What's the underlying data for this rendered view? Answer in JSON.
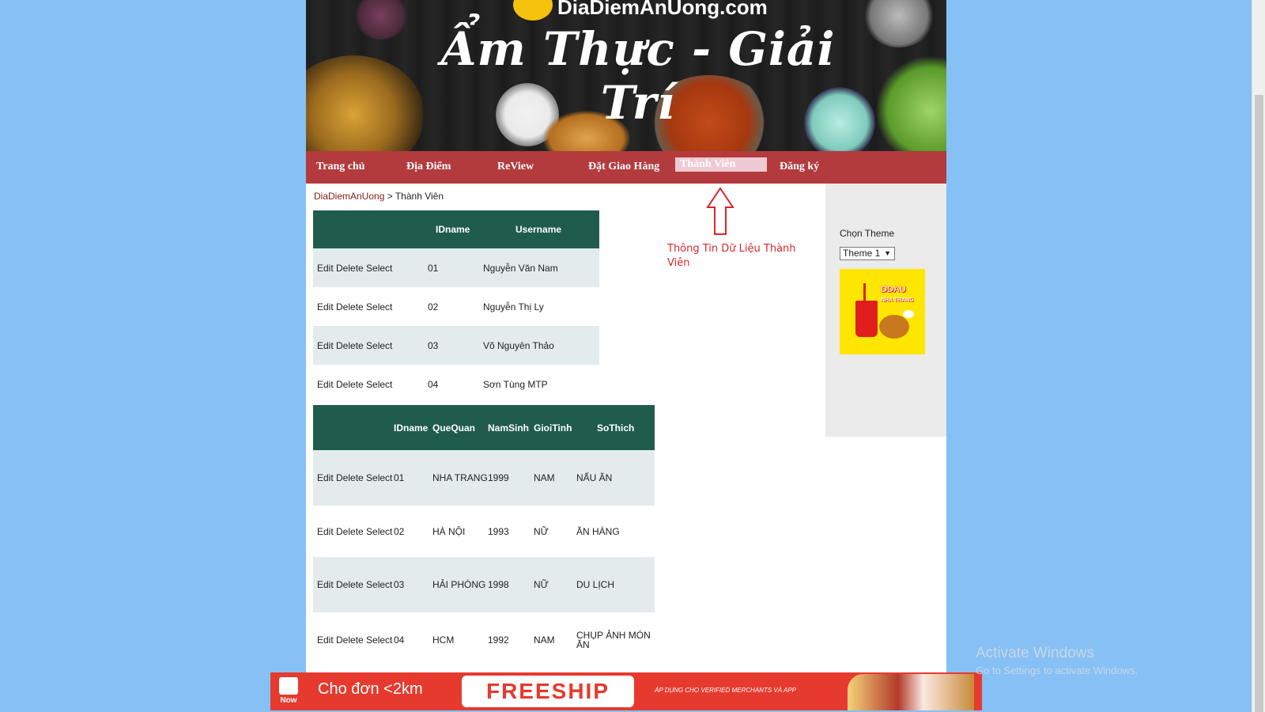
{
  "banner": {
    "logo_text": "DiaDiemAnUong.com",
    "title": "Ẩm Thực - Giải Trí"
  },
  "nav": {
    "items": [
      "Trang chủ",
      "Địa Điểm",
      "ReView",
      "Đặt Giao Hàng",
      "Thành Viên",
      "Đăng ký"
    ],
    "active_index": 4
  },
  "breadcrumb": {
    "home": "DiaDiemAnUong",
    "separator": " > ",
    "current": "Thành Viên"
  },
  "members_table": {
    "headers": [
      "",
      "IDname",
      "Username"
    ],
    "rows": [
      {
        "action": "Edit Delete Select",
        "id": "01",
        "username": "Nguyễn Văn Nam"
      },
      {
        "action": "Edit Delete Select",
        "id": "02",
        "username": "Nguyễn Thị Ly"
      },
      {
        "action": "Edit Delete Select",
        "id": "03",
        "username": "Võ Nguyên Thảo"
      },
      {
        "action": "Edit Delete Select",
        "id": "04",
        "username": "Sơn Tùng MTP"
      }
    ]
  },
  "details_table": {
    "headers": [
      "",
      "IDname",
      "QueQuan",
      "NamSinh",
      "GioiTinh",
      "SoThich"
    ],
    "rows": [
      {
        "action": "Edit Delete Select",
        "id": "01",
        "quequan": "NHA TRANG",
        "namsinh": "1999",
        "gioitinh": "NAM",
        "sothich": "NẤU ĂN"
      },
      {
        "action": "Edit Delete Select",
        "id": "02",
        "quequan": "HÀ NỘI",
        "namsinh": "1993",
        "gioitinh": "NỮ",
        "sothich": "ĂN HÀNG"
      },
      {
        "action": "Edit Delete Select",
        "id": "03",
        "quequan": "HẢI PHÒNG",
        "namsinh": "1998",
        "gioitinh": "NỮ",
        "sothich": "DU LỊCH"
      },
      {
        "action": "Edit Delete Select",
        "id": "04",
        "quequan": "HCM",
        "namsinh": "1992",
        "gioitinh": "NAM",
        "sothich": "CHỤP ẢNH MÓN ĂN"
      }
    ]
  },
  "annotation": {
    "text": "Thông Tin Dữ Liệu Thành Viên",
    "icon": "up-arrow-icon",
    "color": "#d9262b"
  },
  "sidebar": {
    "theme_label": "Chọn Theme",
    "theme_selected": "Theme 1",
    "ad_text_1": "DDAU",
    "ad_text_2": "NHA TRANG"
  },
  "bottom_ad": {
    "now_label": "Now",
    "headline": "Cho đơn <2km",
    "cta": "FREESHIP",
    "subtext": "ÁP DỤNG CHO VERIFIED MERCHANTS VÀ APP"
  },
  "os_overlay": {
    "title": "Activate Windows",
    "subtitle": "Go to Settings to activate Windows."
  },
  "colors": {
    "nav_bg": "#b33b3e",
    "table_header_bg": "#1f5c4e",
    "row_alt_bg": "#e3ebec",
    "page_bg": "#87c0f5"
  }
}
